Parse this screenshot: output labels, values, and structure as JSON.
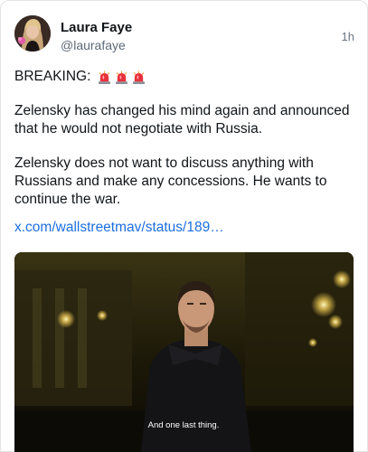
{
  "post": {
    "author": {
      "display_name": "Laura Faye",
      "handle": "@laurafaye",
      "avatar": "avatar-photo"
    },
    "timestamp": "1h",
    "breaking_label": "BREAKING:",
    "emoji": [
      "siren-icon",
      "siren-icon",
      "siren-icon"
    ],
    "paragraph_1": "Zelensky has changed his mind again and announced that he would not negotiate with Russia.",
    "paragraph_2": "Zelensky does not want to discuss anything with Russians and make any concessions. He wants to continue the war.",
    "link_text": "x.com/wallstreetmav/status/189…",
    "media": {
      "type": "video-still",
      "caption": "And one last thing."
    }
  },
  "colors": {
    "link": "#1d6fe0",
    "text": "#101418",
    "muted": "#5e6a78"
  }
}
